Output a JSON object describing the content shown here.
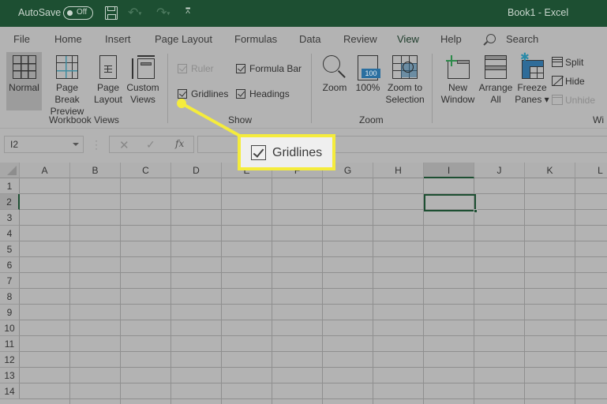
{
  "titlebar": {
    "autosave_label": "AutoSave",
    "autosave_state": "Off",
    "document_title": "Book1  -  Excel",
    "colors": {
      "background": "#1d4f32",
      "text": "#c9d6cd"
    }
  },
  "tabs": [
    {
      "label": "File"
    },
    {
      "label": "Home"
    },
    {
      "label": "Insert"
    },
    {
      "label": "Page Layout"
    },
    {
      "label": "Formulas"
    },
    {
      "label": "Data"
    },
    {
      "label": "Review"
    },
    {
      "label": "View",
      "active": true
    },
    {
      "label": "Help"
    }
  ],
  "search": {
    "label": "Search",
    "icon": "search-icon"
  },
  "ribbon": {
    "workbook_views": {
      "label": "Workbook Views",
      "buttons": [
        {
          "line1": "Normal",
          "line2": "",
          "icon": "normal-view-icon",
          "selected": true
        },
        {
          "line1": "Page Break",
          "line2": "Preview",
          "icon": "page-break-preview-icon"
        },
        {
          "line1": "Page",
          "line2": "Layout",
          "icon": "page-layout-icon"
        },
        {
          "line1": "Custom",
          "line2": "Views",
          "icon": "custom-views-icon"
        }
      ]
    },
    "show": {
      "label": "Show",
      "checkboxes": [
        {
          "label": "Ruler",
          "checked": true,
          "disabled": true
        },
        {
          "label": "Formula Bar",
          "checked": true,
          "disabled": false
        },
        {
          "label": "Gridlines",
          "checked": true,
          "disabled": false
        },
        {
          "label": "Headings",
          "checked": true,
          "disabled": false
        }
      ]
    },
    "zoom": {
      "label": "Zoom",
      "buttons": [
        {
          "line1": "Zoom",
          "line2": "",
          "icon": "zoom-icon"
        },
        {
          "line1": "100%",
          "line2": "",
          "icon": "zoom-100-icon",
          "badge": "100"
        },
        {
          "line1": "Zoom to",
          "line2": "Selection",
          "icon": "zoom-to-selection-icon"
        }
      ]
    },
    "window": {
      "label": "Wi",
      "buttons": [
        {
          "line1": "New",
          "line2": "Window",
          "icon": "new-window-icon"
        },
        {
          "line1": "Arrange",
          "line2": "All",
          "icon": "arrange-all-icon"
        },
        {
          "line1": "Freeze",
          "line2": "Panes ▾",
          "icon": "freeze-panes-icon"
        }
      ],
      "small_buttons": [
        {
          "label": "Split",
          "icon": "split-icon",
          "disabled": false
        },
        {
          "label": "Hide",
          "icon": "hide-icon",
          "disabled": false
        },
        {
          "label": "Unhide",
          "icon": "unhide-icon",
          "disabled": true
        }
      ]
    }
  },
  "formula_bar": {
    "name_box_value": "I2",
    "cancel_symbol": "✕",
    "enter_symbol": "✓",
    "fx_symbol": "fx",
    "formula_value": ""
  },
  "sheet": {
    "columns": [
      "A",
      "B",
      "C",
      "D",
      "E",
      "F",
      "G",
      "H",
      "I",
      "J",
      "K",
      "L"
    ],
    "rows": [
      "1",
      "2",
      "3",
      "4",
      "5",
      "6",
      "7",
      "8",
      "9",
      "10",
      "11",
      "12",
      "13",
      "14"
    ],
    "active_cell": "I2",
    "active_column": "I",
    "active_row": "2"
  },
  "callout": {
    "label": "Gridlines",
    "checked": true,
    "border_color": "#f5ec3c"
  }
}
